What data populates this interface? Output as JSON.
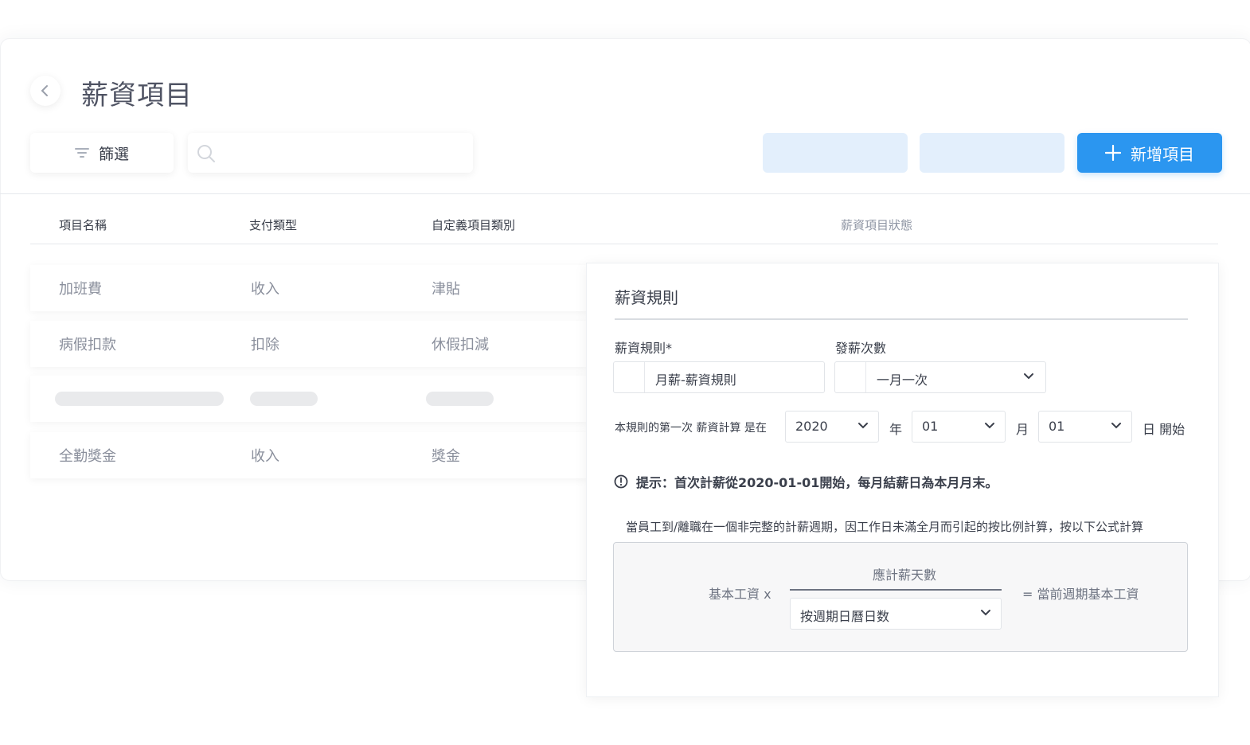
{
  "header": {
    "title": "薪資項目"
  },
  "toolbar": {
    "filter_label": "篩選",
    "search_placeholder": "",
    "add_label": "新增項目"
  },
  "table": {
    "columns": [
      "項目名稱",
      "支付類型",
      "自定義項目類別",
      "薪資項目狀態"
    ],
    "rows": [
      {
        "name": "加班費",
        "type": "收入",
        "category": "津貼"
      },
      {
        "name": "病假扣款",
        "type": "扣除",
        "category": "休假扣減"
      },
      {
        "name": "全勤獎金",
        "type": "收入",
        "category": "獎金"
      }
    ]
  },
  "panel": {
    "title": "薪資規則",
    "rule_label": "薪資規則*",
    "rule_value": "月薪-薪資規則",
    "frequency_label": "發薪次數",
    "frequency_value": "一月一次",
    "first_calc_label": "本規則的第一次 薪資計算 是在",
    "year_value": "2020",
    "year_unit": "年",
    "month_value": "01",
    "month_unit": "月",
    "day_value": "01",
    "day_unit": "日 開始",
    "hint": "提示：首次計薪從2020-01-01開始，每月結薪日為本月月末。",
    "note": "當員工到/離職在一個非完整的計薪週期，因工作日未滿全月而引起的按比例計算，按以下公式計算",
    "formula": {
      "left": "基本工資 x",
      "numerator": "應計薪天數",
      "denominator": "按週期日曆日数",
      "result": "= 當前週期基本工資"
    }
  },
  "colors": {
    "accent": "#2b96f0",
    "ghost": "#e3effc"
  }
}
